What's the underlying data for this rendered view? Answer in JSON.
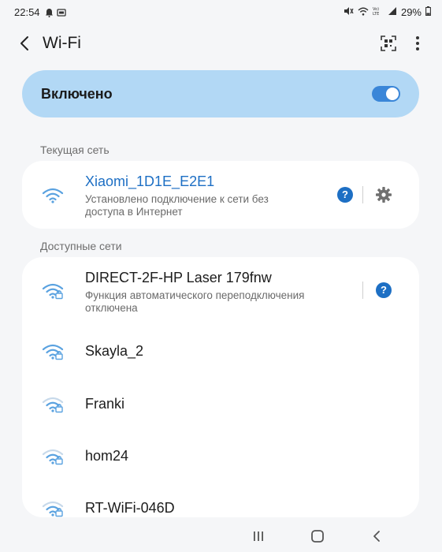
{
  "status_bar": {
    "time": "22:54",
    "left_icons": [
      "notification-icon",
      "photo-icon"
    ],
    "right_icons": [
      "mute-icon",
      "wifi-status-icon",
      "volte-icon",
      "signal-icon"
    ],
    "battery": "29%"
  },
  "app_bar": {
    "title": "Wi-Fi",
    "back_icon": "back-arrow-icon",
    "qr_icon": "qr-scan-icon",
    "more_icon": "more-vert-icon"
  },
  "master_toggle": {
    "label": "Включено",
    "enabled": true
  },
  "current_section": {
    "label": "Текущая сеть",
    "network": {
      "name": "Xiaomi_1D1E_E2E1",
      "status_line1": "Установлено подключение к сети без",
      "status_line2": "доступа в Интернет",
      "secured": false
    }
  },
  "available_section": {
    "label": "Доступные сети",
    "networks": [
      {
        "name": "DIRECT-2F-HP Laser 179fnw",
        "sub1": "Функция автоматического переподключения",
        "sub2": "отключена",
        "secured": true,
        "strength": 3
      },
      {
        "name": "Skayla_2",
        "secured": true,
        "strength": 3
      },
      {
        "name": "Franki",
        "secured": true,
        "strength": 2
      },
      {
        "name": "hom24",
        "secured": true,
        "strength": 2
      },
      {
        "name": "RT-WiFi-046D",
        "secured": true,
        "strength": 2
      }
    ]
  },
  "colors": {
    "accent": "#1d6fc4",
    "toggle_card": "#b2d8f5",
    "switch_on": "#3a86d8",
    "background": "#f5f6f8"
  },
  "nav_bar": {
    "icons": [
      "recents-icon",
      "home-icon",
      "back-nav-icon"
    ]
  }
}
